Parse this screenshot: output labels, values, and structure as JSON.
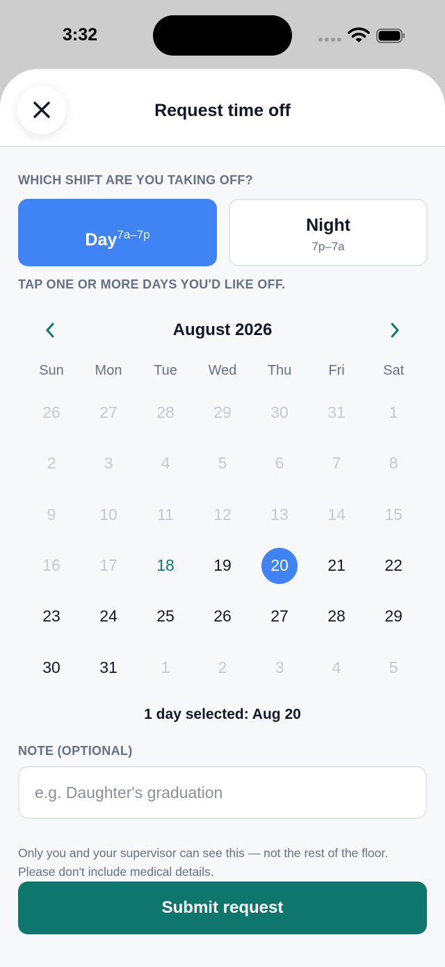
{
  "status_bar": {
    "time": "3:32"
  },
  "header": {
    "title": "Request time off"
  },
  "shift_section": {
    "label": "WHICH SHIFT ARE YOU TAKING OFF?",
    "options": [
      {
        "name": "Day",
        "hours": "7a–7p",
        "selected": true
      },
      {
        "name": "Night",
        "hours": "7p–7a",
        "selected": false
      }
    ]
  },
  "days_section": {
    "label": "TAP ONE OR MORE DAYS YOU'D LIKE OFF."
  },
  "calendar": {
    "month": "August 2026",
    "weekdays": [
      "Sun",
      "Mon",
      "Tue",
      "Wed",
      "Thu",
      "Fri",
      "Sat"
    ],
    "weeks": [
      [
        {
          "d": "26",
          "state": "muted"
        },
        {
          "d": "27",
          "state": "muted"
        },
        {
          "d": "28",
          "state": "muted"
        },
        {
          "d": "29",
          "state": "muted"
        },
        {
          "d": "30",
          "state": "muted"
        },
        {
          "d": "31",
          "state": "muted"
        },
        {
          "d": "1",
          "state": "muted"
        }
      ],
      [
        {
          "d": "2",
          "state": "muted"
        },
        {
          "d": "3",
          "state": "muted"
        },
        {
          "d": "4",
          "state": "muted"
        },
        {
          "d": "5",
          "state": "muted"
        },
        {
          "d": "6",
          "state": "muted"
        },
        {
          "d": "7",
          "state": "muted"
        },
        {
          "d": "8",
          "state": "muted"
        }
      ],
      [
        {
          "d": "9",
          "state": "muted"
        },
        {
          "d": "10",
          "state": "muted"
        },
        {
          "d": "11",
          "state": "muted"
        },
        {
          "d": "12",
          "state": "muted"
        },
        {
          "d": "13",
          "state": "muted"
        },
        {
          "d": "14",
          "state": "muted"
        },
        {
          "d": "15",
          "state": "muted"
        }
      ],
      [
        {
          "d": "16",
          "state": "muted"
        },
        {
          "d": "17",
          "state": "muted"
        },
        {
          "d": "18",
          "state": "today"
        },
        {
          "d": "19",
          "state": "normal"
        },
        {
          "d": "20",
          "state": "selected"
        },
        {
          "d": "21",
          "state": "normal"
        },
        {
          "d": "22",
          "state": "normal"
        }
      ],
      [
        {
          "d": "23",
          "state": "normal"
        },
        {
          "d": "24",
          "state": "normal"
        },
        {
          "d": "25",
          "state": "normal"
        },
        {
          "d": "26",
          "state": "normal"
        },
        {
          "d": "27",
          "state": "normal"
        },
        {
          "d": "28",
          "state": "normal"
        },
        {
          "d": "29",
          "state": "normal"
        }
      ],
      [
        {
          "d": "30",
          "state": "normal"
        },
        {
          "d": "31",
          "state": "normal"
        },
        {
          "d": "1",
          "state": "muted"
        },
        {
          "d": "2",
          "state": "muted"
        },
        {
          "d": "3",
          "state": "muted"
        },
        {
          "d": "4",
          "state": "muted"
        },
        {
          "d": "5",
          "state": "muted"
        }
      ]
    ],
    "summary": "1 day selected: Aug 20"
  },
  "note": {
    "label": "NOTE (OPTIONAL)",
    "value": "",
    "placeholder": "e.g. Daughter's graduation"
  },
  "privacy_text": "Only you and your supervisor can see this — not the rest of the floor. Please don't include medical details.",
  "submit_label": "Submit request",
  "colors": {
    "accent_blue": "#3f83f5",
    "primary_green": "#0f766e",
    "muted_text": "#667085",
    "disabled_day": "#c4c9d1"
  },
  "icons": [
    "close-icon",
    "chevron-left-icon",
    "chevron-right-icon",
    "wifi-icon",
    "battery-icon",
    "cellular-signal-icon"
  ]
}
